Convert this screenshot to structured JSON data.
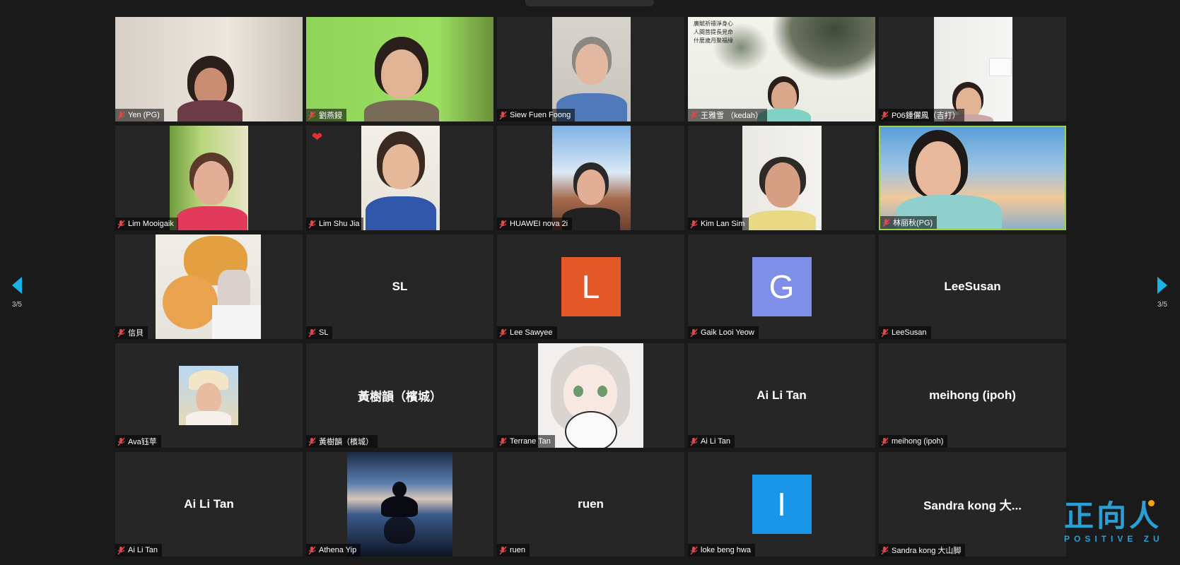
{
  "pagination": {
    "left_label": "3/5",
    "right_label": "3/5"
  },
  "heart_glyph": "❤",
  "logo": {
    "chinese": "正向人",
    "english": "POSITIVE ZU"
  },
  "tiles": [
    {
      "name": "Yen (PG)"
    },
    {
      "name": "劉燕鋟"
    },
    {
      "name": "Siew Fuen Foong"
    },
    {
      "name": "王雅雪 （kedah）",
      "overlay_text": "廣賦祈禱淨身心\n人間菩提長見命\n什麼歲月聚福緣"
    },
    {
      "name": "P06鍾儷鳳（吉打）"
    },
    {
      "name": "Lim Mooigaik"
    },
    {
      "name": "Lim Shu Jia"
    },
    {
      "name": "HUAWEI nova 2i"
    },
    {
      "name": "Kim Lan Sim"
    },
    {
      "name": "林丽秋(PG)"
    },
    {
      "name": "信貝"
    },
    {
      "name": "SL",
      "center": "SL"
    },
    {
      "name": "Lee Sawyee",
      "avatar_letter": "L",
      "avatar_color": "#e4582a"
    },
    {
      "name": "Gaik Looi Yeow",
      "avatar_letter": "G",
      "avatar_color": "#7f8fe8"
    },
    {
      "name": "LeeSusan",
      "center": "LeeSusan"
    },
    {
      "name": "Ava钰苹"
    },
    {
      "name": "黃樹韻（檳城）",
      "center": "黃樹韻（檳城）"
    },
    {
      "name": "Terrane Tan"
    },
    {
      "name": "Ai Li Tan",
      "center": "Ai Li Tan"
    },
    {
      "name": "meihong (ipoh)",
      "center": "meihong (ipoh)"
    },
    {
      "name": "Ai Li Tan",
      "center": "Ai Li Tan"
    },
    {
      "name": "Athena Yip"
    },
    {
      "name": "ruen",
      "center": "ruen"
    },
    {
      "name": "loke beng hwa",
      "avatar_letter": "I",
      "avatar_color": "#1a96e8"
    },
    {
      "name": "Sandra kong 大山脚",
      "center": "Sandra  kong 大..."
    }
  ]
}
